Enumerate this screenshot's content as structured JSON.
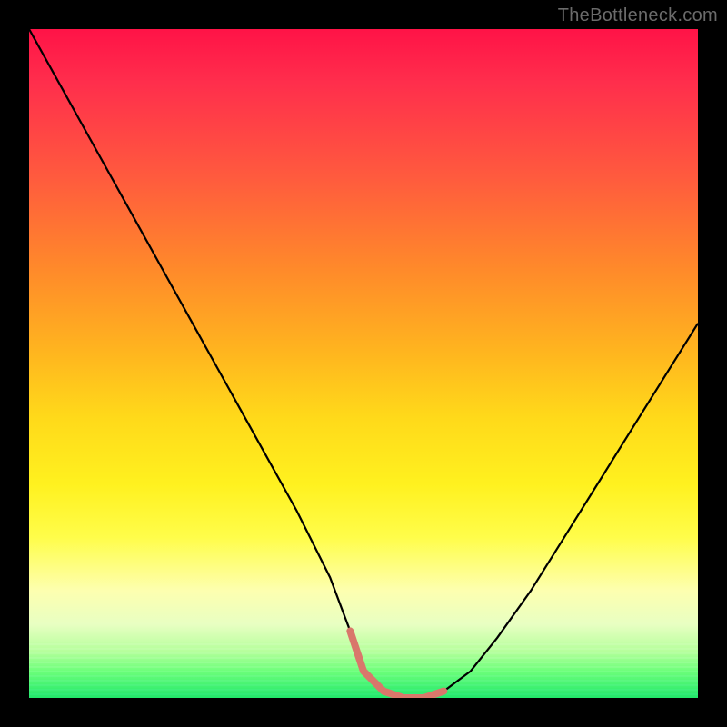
{
  "watermark": {
    "text": "TheBottleneck.com"
  },
  "chart_data": {
    "type": "line",
    "title": "",
    "xlabel": "",
    "ylabel": "",
    "xlim": [
      0,
      100
    ],
    "ylim": [
      0,
      100
    ],
    "grid": false,
    "legend": "none",
    "annotations": [],
    "series": [
      {
        "name": "bottleneck-curve",
        "color": "#000000",
        "x": [
          0,
          5,
          10,
          15,
          20,
          25,
          30,
          35,
          40,
          45,
          48,
          50,
          53,
          56,
          59,
          62,
          66,
          70,
          75,
          80,
          85,
          90,
          95,
          100
        ],
        "values": [
          100,
          91,
          82,
          73,
          64,
          55,
          46,
          37,
          28,
          18,
          10,
          4,
          1,
          0,
          0,
          1,
          4,
          9,
          16,
          24,
          32,
          40,
          48,
          56
        ]
      },
      {
        "name": "optimal-range-highlight",
        "color": "#d9776b",
        "x": [
          48,
          50,
          53,
          56,
          59,
          62
        ],
        "values": [
          10,
          4,
          1,
          0,
          0,
          1
        ]
      }
    ],
    "optimal_range_x": [
      48,
      62
    ]
  },
  "colors": {
    "gradient_top": "#ff1347",
    "gradient_bottom": "#22e86b",
    "curve": "#000000",
    "highlight": "#d9776b",
    "frame": "#000000",
    "watermark": "#6b6b6b"
  }
}
